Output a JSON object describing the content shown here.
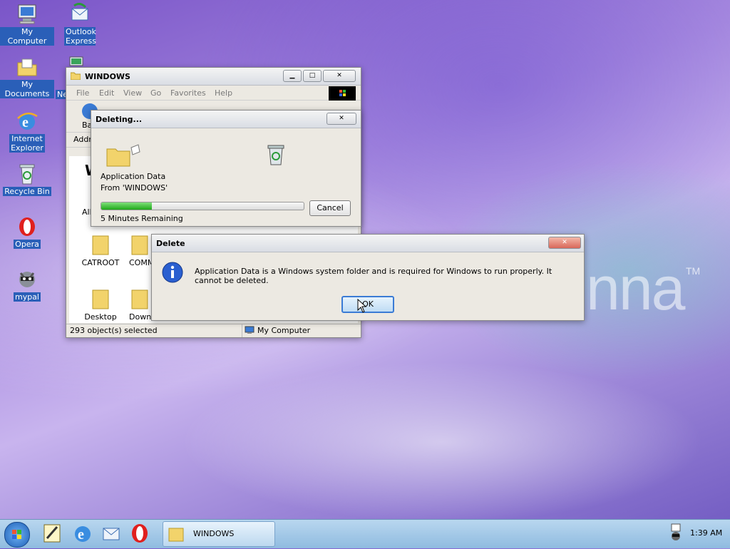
{
  "brand": {
    "text": "nna",
    "tm": "TM"
  },
  "desktop_icons": [
    {
      "label": "My Computer"
    },
    {
      "label": "Outlook Express"
    },
    {
      "label": "My Documents"
    },
    {
      "label": "Ne"
    },
    {
      "label": "Internet Explorer"
    },
    {
      "label": "Recycle Bin"
    },
    {
      "label": "Opera"
    },
    {
      "label": "mypal"
    }
  ],
  "explorer": {
    "title": "WINDOWS",
    "menu": [
      "File",
      "Edit",
      "View",
      "Go",
      "Favorites",
      "Help"
    ],
    "back_label": "Ba",
    "address_label": "Addre",
    "big_letter": "W",
    "all_label": "All",
    "files": [
      "CATROOT",
      "COMM",
      "Desktop",
      "Downlo"
    ],
    "status_left": "293 object(s) selected",
    "status_right": "My Computer"
  },
  "deleting": {
    "title": "Deleting...",
    "item": "Application Data",
    "from": "From 'WINDOWS'",
    "progress": 0.25,
    "remaining": "5 Minutes Remaining",
    "cancel": "Cancel"
  },
  "delete_dialog": {
    "title": "Delete",
    "message": "Application Data is a Windows system folder and is required for Windows to run properly. It cannot be deleted.",
    "ok": "OK"
  },
  "taskbar": {
    "task_label": "WINDOWS",
    "clock": "1:39 AM"
  }
}
